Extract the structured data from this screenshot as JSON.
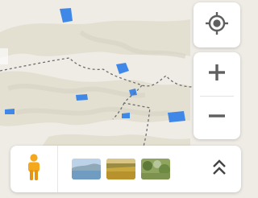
{
  "map": {
    "background_color": "#efece6",
    "terrain_color": "#e3e1d2",
    "water_color": "#3f88e8",
    "boundary_color": "#6e6e6e"
  },
  "controls": {
    "locate_icon": "crosshair-icon",
    "zoom_in_icon": "plus-icon",
    "zoom_out_icon": "minus-icon",
    "icon_color": "#5f5f5f"
  },
  "layer_bar": {
    "pegman_icon": "pegman-icon",
    "pegman_color": "#f4a81d",
    "thumbnails": [
      "lake-landscape-thumbnail",
      "grassland-thumbnail",
      "shrubland-thumbnail"
    ],
    "expand_icon": "double-chevron-up-icon"
  }
}
